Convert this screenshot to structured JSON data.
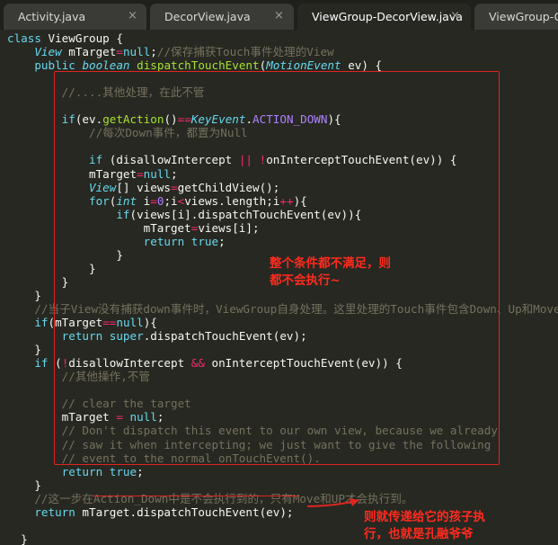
{
  "tabs": [
    {
      "label": "Activity.java",
      "active": false
    },
    {
      "label": "DecorView.java",
      "active": false
    },
    {
      "label": "ViewGroup-DecorView.java",
      "active": true
    },
    {
      "label": "ViewGroup-Gr",
      "active": false
    }
  ],
  "close_glyph": "×",
  "annotations": {
    "box_note_1": "整个条件都不满足，则",
    "box_note_2": "都不会执行~",
    "bottom_note_1": "则就传递给它的孩子执",
    "bottom_note_2": "行，也就是孔融爷爷"
  },
  "code_lines": [
    [
      [
        "kw",
        "class"
      ],
      [
        "pl",
        " ViewGroup {"
      ]
    ],
    [
      [
        "pl",
        "    "
      ],
      [
        "type",
        "View"
      ],
      [
        "pl",
        " mTarget"
      ],
      [
        "op",
        "="
      ],
      [
        "kw",
        "null"
      ],
      [
        "pl",
        ";"
      ],
      [
        "cmt",
        "//保存捕获Touch事件处理的View"
      ]
    ],
    [
      [
        "pl",
        "    "
      ],
      [
        "kw",
        "public"
      ],
      [
        "pl",
        " "
      ],
      [
        "type",
        "boolean"
      ],
      [
        "pl",
        " "
      ],
      [
        "fn",
        "dispatchTouchEvent"
      ],
      [
        "pl",
        "("
      ],
      [
        "type",
        "MotionEvent"
      ],
      [
        "pl",
        " "
      ],
      [
        "var",
        "ev"
      ],
      [
        "pl",
        ") {"
      ]
    ],
    [
      [
        "pl",
        ""
      ]
    ],
    [
      [
        "pl",
        "        "
      ],
      [
        "cmt",
        "//....其他处理，在此不管"
      ]
    ],
    [
      [
        "pl",
        ""
      ]
    ],
    [
      [
        "pl",
        "        "
      ],
      [
        "kw",
        "if"
      ],
      [
        "pl",
        "(ev."
      ],
      [
        "fn",
        "getAction"
      ],
      [
        "pl",
        "()"
      ],
      [
        "op",
        "=="
      ],
      [
        "type",
        "KeyEvent"
      ],
      [
        "pl",
        "."
      ],
      [
        "const",
        "ACTION_DOWN"
      ],
      [
        "pl",
        "){"
      ]
    ],
    [
      [
        "pl",
        "            "
      ],
      [
        "cmt",
        "//每次Down事件，都置为Null"
      ]
    ],
    [
      [
        "pl",
        ""
      ]
    ],
    [
      [
        "pl",
        "            "
      ],
      [
        "kw",
        "if"
      ],
      [
        "pl",
        " (disallowIntercept "
      ],
      [
        "op",
        "||"
      ],
      [
        "pl",
        " "
      ],
      [
        "op",
        "!"
      ],
      [
        "pl",
        "onInterceptTouchEvent(ev)) {"
      ]
    ],
    [
      [
        "pl",
        "            mTarget"
      ],
      [
        "op",
        "="
      ],
      [
        "kw",
        "null"
      ],
      [
        "pl",
        ";"
      ]
    ],
    [
      [
        "pl",
        "            "
      ],
      [
        "type",
        "View"
      ],
      [
        "pl",
        "[] views"
      ],
      [
        "op",
        "="
      ],
      [
        "pl",
        "getChildView();"
      ]
    ],
    [
      [
        "pl",
        "            "
      ],
      [
        "kw",
        "for"
      ],
      [
        "pl",
        "("
      ],
      [
        "type",
        "int"
      ],
      [
        "pl",
        " i"
      ],
      [
        "op",
        "="
      ],
      [
        "num",
        "0"
      ],
      [
        "pl",
        ";i"
      ],
      [
        "op",
        "<"
      ],
      [
        "pl",
        "views."
      ],
      [
        "pl",
        "length;i"
      ],
      [
        "op",
        "++"
      ],
      [
        "pl",
        "){"
      ]
    ],
    [
      [
        "pl",
        "                "
      ],
      [
        "kw",
        "if"
      ],
      [
        "pl",
        "(views[i]."
      ],
      [
        "pl",
        "dispatchTouchEvent(ev)){"
      ]
    ],
    [
      [
        "pl",
        "                    mTarget"
      ],
      [
        "op",
        "="
      ],
      [
        "pl",
        "views[i];"
      ]
    ],
    [
      [
        "pl",
        "                    "
      ],
      [
        "kw",
        "return"
      ],
      [
        "pl",
        " "
      ],
      [
        "kw",
        "true"
      ],
      [
        "pl",
        ";"
      ]
    ],
    [
      [
        "pl",
        "                }"
      ]
    ],
    [
      [
        "pl",
        "            }"
      ]
    ],
    [
      [
        "pl",
        "        }"
      ]
    ],
    [
      [
        "pl",
        "    }"
      ]
    ],
    [
      [
        "pl",
        "    "
      ],
      [
        "cmt",
        "//当子View没有捕获down事件时，ViewGroup自身处理。这里处理的Touch事件包含Down、Up和Move"
      ]
    ],
    [
      [
        "pl",
        "    "
      ],
      [
        "kw",
        "if"
      ],
      [
        "pl",
        "(mTarget"
      ],
      [
        "op",
        "=="
      ],
      [
        "kw",
        "null"
      ],
      [
        "pl",
        "){"
      ]
    ],
    [
      [
        "pl",
        "        "
      ],
      [
        "kw",
        "return"
      ],
      [
        "pl",
        " "
      ],
      [
        "kw",
        "super"
      ],
      [
        "pl",
        "."
      ],
      [
        "pl",
        "dispatchTouchEvent(ev);"
      ]
    ],
    [
      [
        "pl",
        "    }"
      ]
    ],
    [
      [
        "pl",
        "    "
      ],
      [
        "kw",
        "if"
      ],
      [
        "pl",
        " ("
      ],
      [
        "op",
        "!"
      ],
      [
        "pl",
        "disallowIntercept "
      ],
      [
        "op",
        "&&"
      ],
      [
        "pl",
        " onInterceptTouchEvent(ev)) {"
      ]
    ],
    [
      [
        "pl",
        "        "
      ],
      [
        "cmt",
        "//其他操作,不管"
      ]
    ],
    [
      [
        "pl",
        ""
      ]
    ],
    [
      [
        "pl",
        "        "
      ],
      [
        "cmt",
        "// clear the target"
      ]
    ],
    [
      [
        "pl",
        "        mTarget "
      ],
      [
        "op",
        "="
      ],
      [
        "pl",
        " "
      ],
      [
        "kw",
        "null"
      ],
      [
        "pl",
        ";"
      ]
    ],
    [
      [
        "pl",
        "        "
      ],
      [
        "cmt",
        "// Don't dispatch this event to our own view, because we already"
      ]
    ],
    [
      [
        "pl",
        "        "
      ],
      [
        "cmt",
        "// saw it when intercepting; we just want to give the following"
      ]
    ],
    [
      [
        "pl",
        "        "
      ],
      [
        "cmt",
        "// event to the normal onTouchEvent()."
      ]
    ],
    [
      [
        "pl",
        "        "
      ],
      [
        "kw",
        "return"
      ],
      [
        "pl",
        " "
      ],
      [
        "kw",
        "true"
      ],
      [
        "pl",
        ";"
      ]
    ],
    [
      [
        "pl",
        "    }"
      ]
    ],
    [
      [
        "pl",
        "    "
      ],
      [
        "cmt",
        "//这一步在Action_Down中是不会执行到的，只有Move和UP才会执行到。"
      ]
    ],
    [
      [
        "pl",
        "    "
      ],
      [
        "kw",
        "return"
      ],
      [
        "pl",
        " mTarget."
      ],
      [
        "pl",
        "dispatchTouchEvent(ev);"
      ]
    ],
    [
      [
        "pl",
        ""
      ]
    ],
    [
      [
        "pl",
        "  }"
      ]
    ]
  ]
}
